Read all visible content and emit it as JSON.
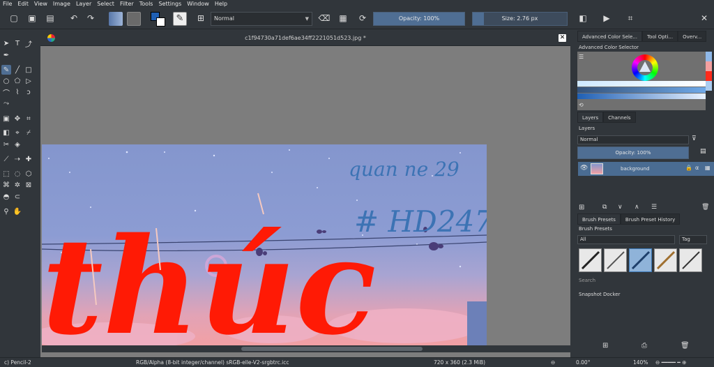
{
  "menu": [
    "File",
    "Edit",
    "View",
    "Image",
    "Layer",
    "Select",
    "Filter",
    "Tools",
    "Settings",
    "Window",
    "Help"
  ],
  "toolbar": {
    "blend_mode": "Normal",
    "opacity_label": "Opacity: 100%",
    "opacity_value": 100,
    "size_label": "Size: 2.76 px"
  },
  "document": {
    "title": "c1f94730a71def6ae34ff2221051d523.jpg *"
  },
  "canvas_text": {
    "line1": "quan ne 29",
    "line2": "# HD247",
    "big": "thúc"
  },
  "right_dock": {
    "top_tabs": [
      "Advanced Color Sele...",
      "Tool Opti...",
      "Overv..."
    ],
    "color_selector_title": "Advanced Color Selector",
    "layer_tabs": [
      "Layers",
      "Channels"
    ],
    "layers_title": "Layers",
    "layers_blend": "Normal",
    "layers_opacity": "Opacity:  100%",
    "layer_name": "background",
    "brush_tabs": [
      "Brush Presets",
      "Brush Preset History"
    ],
    "brush_presets_title": "Brush Presets",
    "brush_filter": "All",
    "tag_label": "Tag",
    "search_label": "Search",
    "snapshot_title": "Snapshot Docker"
  },
  "colors": {
    "accent": "#4f6e93",
    "fg_color": "#1e5fb4",
    "bg_color": "#ffffff",
    "red_stroke": "#ff1a05"
  },
  "status": {
    "brush": "c) Pencil-2",
    "color_model": "RGB/Alpha (8-bit integer/channel)  sRGB-elle-V2-srgbtrc.icc",
    "image_size": "720 x 360 (2.3 MiB)",
    "rotation": "0.00°",
    "zoom": "140%"
  }
}
